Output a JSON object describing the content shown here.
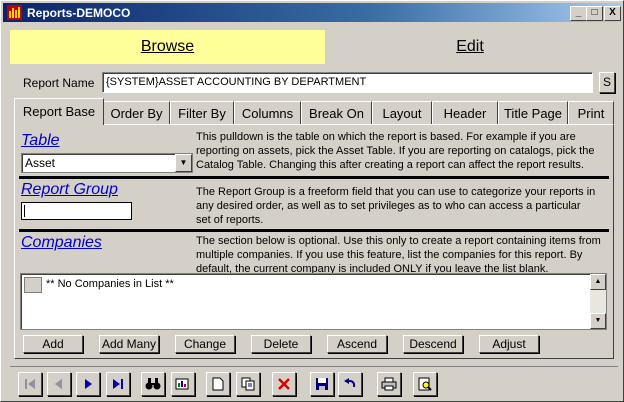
{
  "window": {
    "title": "Reports-DEMOCO",
    "min": "_",
    "max": "□",
    "close": "X"
  },
  "mode_tabs": {
    "browse": "Browse",
    "edit": "Edit"
  },
  "report_name": {
    "label": "Report Name",
    "value": "{SYSTEM}ASSET ACCOUNTING BY DEPARTMENT",
    "side_button": "S"
  },
  "tabs": [
    "Report Base",
    "Order By",
    "Filter By",
    "Columns",
    "Break On",
    "Layout",
    "Header",
    "Title Page",
    "Print"
  ],
  "active_tab": "Report Base",
  "table_section": {
    "title": "Table",
    "selected": "Asset",
    "desc_lines": [
      "This pulldown is the table on which the report is based.  For example if you are",
      "reporting on assets, pick the Asset Table.  If you are reporting on catalogs, pick the",
      "Catalog Table.  Changing this after creating a report can affect the report results."
    ]
  },
  "group_section": {
    "title": "Report Group",
    "value": "",
    "desc_lines": [
      "The Report Group is a freeform field that you can use to categorize your reports in",
      "any desired order, as well as to set privileges as to who can access a particular",
      "set of reports."
    ]
  },
  "companies_section": {
    "title": "Companies",
    "desc_lines": [
      "The section below is optional.  Use this only to create a report containing items from",
      "multiple companies.  If you use this feature, list the companies for this report.  By",
      "default, the current company is included ONLY if you leave the list blank."
    ],
    "list_items": [
      "** No Companies in List **"
    ]
  },
  "action_buttons": [
    "Add",
    "Add Many",
    "Change",
    "Delete",
    "Ascend",
    "Descend",
    "Adjust"
  ],
  "toolbar_icons": [
    "first-record-icon",
    "prev-record-icon",
    "next-record-icon",
    "last-record-icon",
    "binoculars-icon",
    "query-icon",
    "new-document-icon",
    "copy-icon",
    "delete-icon",
    "save-icon",
    "undo-icon",
    "print-icon",
    "preview-icon"
  ]
}
